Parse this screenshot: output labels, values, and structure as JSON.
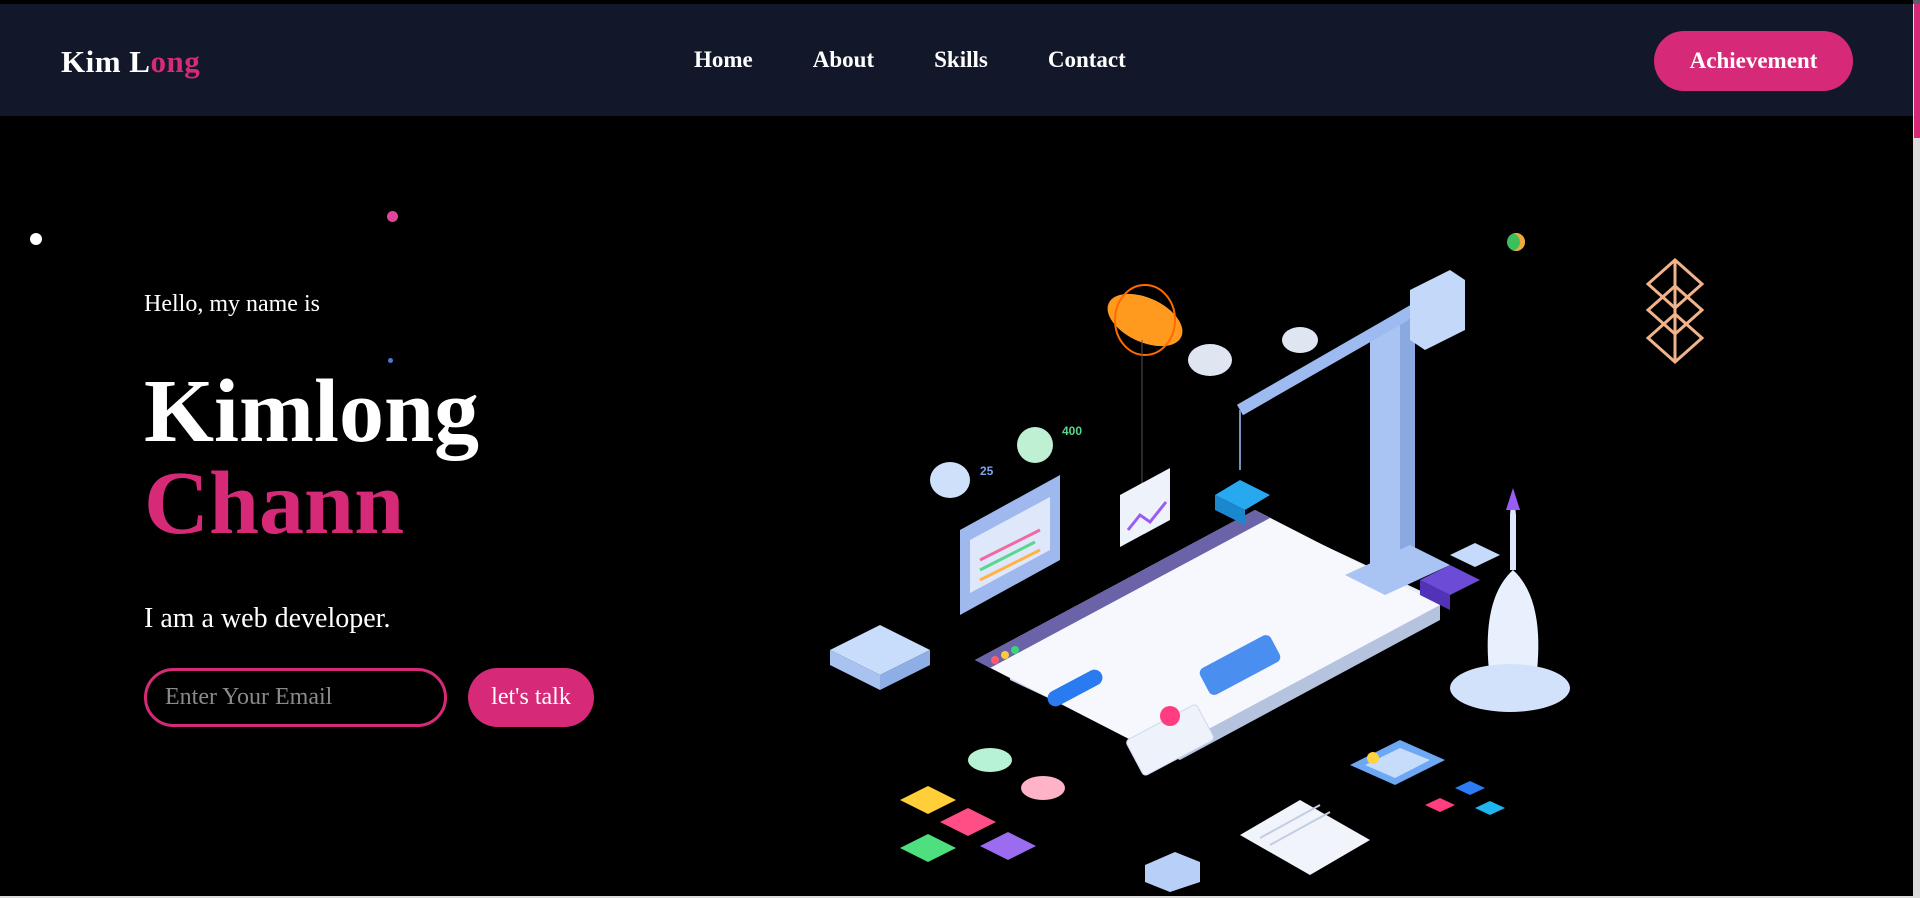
{
  "navbar": {
    "brand_part1": "Kim L",
    "brand_part2": "ong",
    "links": [
      "Home",
      "About",
      "Skills",
      "Contact"
    ],
    "cta_label": "Achievement"
  },
  "hero": {
    "greeting": "Hello, my name is",
    "first_name": "Kimlong",
    "last_name": "Chann",
    "tagline": "I am a web developer.",
    "email_placeholder": "Enter Your Email",
    "talk_label": "let's talk",
    "illustration_labels": {
      "small_number": "25",
      "large_number": "400"
    }
  },
  "colors": {
    "accent": "#d62a78",
    "navbar_bg": "#121829",
    "page_bg": "#000000"
  },
  "icons": [
    "isometric-web-illustration",
    "diamond-decoration-icon"
  ]
}
